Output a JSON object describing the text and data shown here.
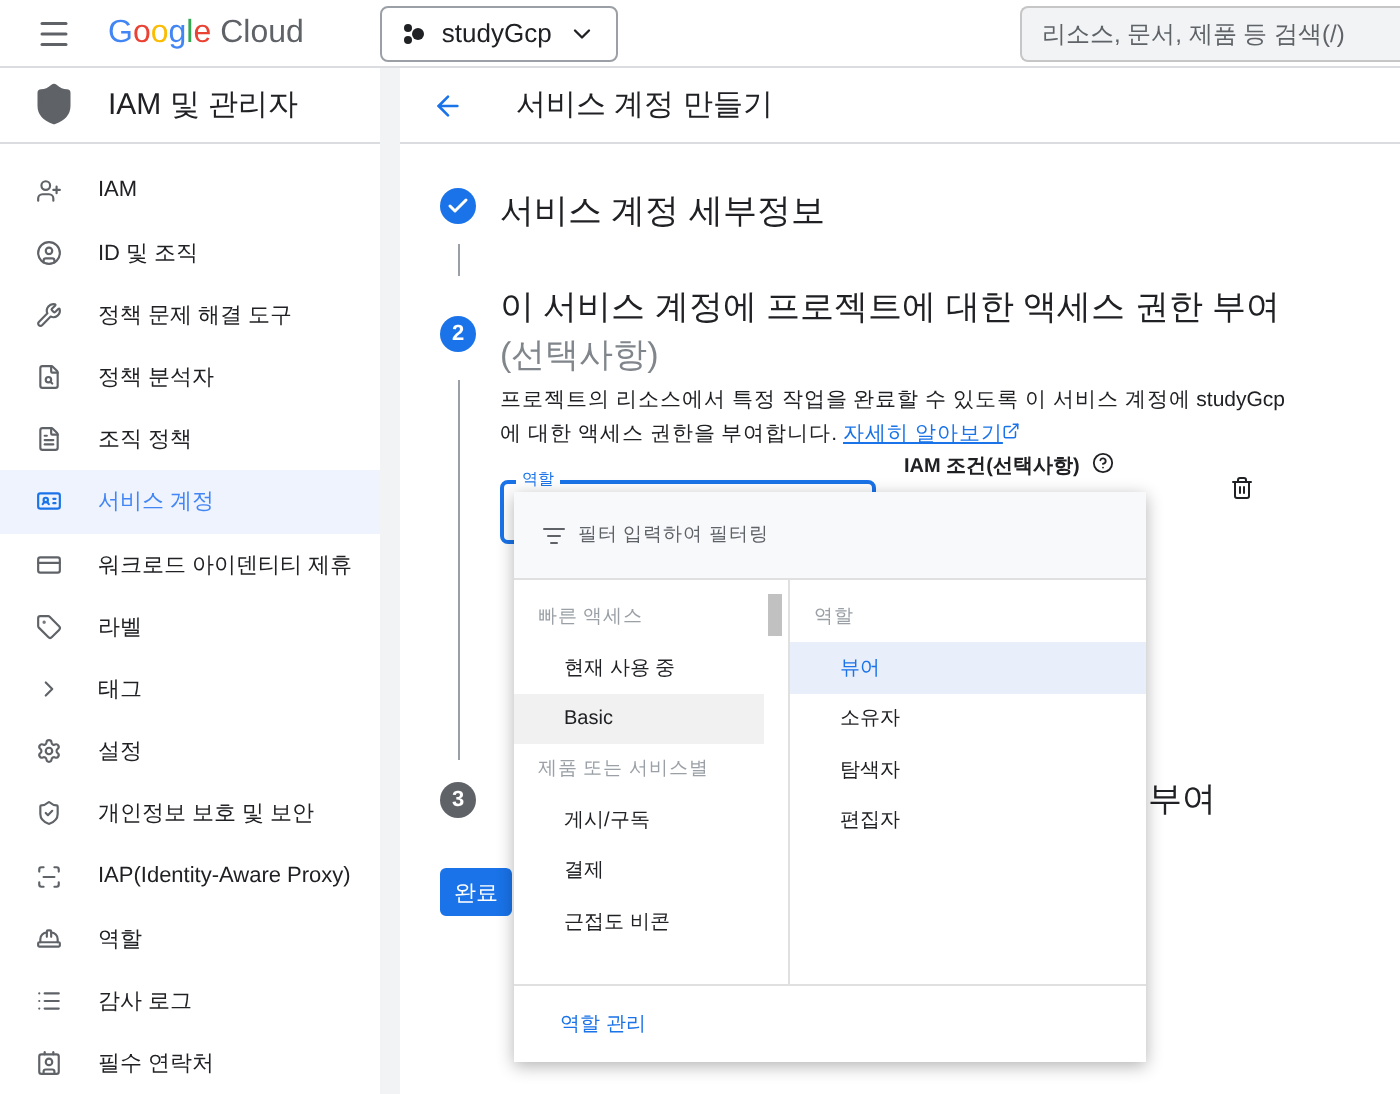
{
  "topbar": {
    "logo": "Google",
    "logo_suffix": "Cloud",
    "project": "studyGcp",
    "search": {
      "placeholder": "리소스, 문서, 제품 등 검색(/)"
    }
  },
  "sidebar": {
    "title": "IAM 및 관리자",
    "items": [
      {
        "label": "IAM",
        "selected": false
      },
      {
        "label": "ID 및 조직",
        "selected": false
      },
      {
        "label": "정책 문제 해결 도구",
        "selected": false
      },
      {
        "label": "정책 분석자",
        "selected": false
      },
      {
        "label": "조직 정책",
        "selected": false
      },
      {
        "label": "서비스 계정",
        "selected": true
      },
      {
        "label": "워크로드 아이덴티티 제휴",
        "selected": false
      },
      {
        "label": "라벨",
        "selected": false
      },
      {
        "label": "태그",
        "selected": false
      },
      {
        "label": "설정",
        "selected": false
      },
      {
        "label": "개인정보 보호 및 보안",
        "selected": false
      },
      {
        "label": "IAP(Identity-Aware Proxy)",
        "selected": false
      },
      {
        "label": "역할",
        "selected": false
      },
      {
        "label": "감사 로그",
        "selected": false
      },
      {
        "label": "필수 연락처",
        "selected": false
      }
    ]
  },
  "page": {
    "title": "서비스 계정 만들기"
  },
  "step1": {
    "title": "서비스 계정 세부정보",
    "done": true
  },
  "step2": {
    "number": "2",
    "title": "이 서비스 계정에 프로젝트에 대한 액세스 권한 부여",
    "optional": "(선택사항)",
    "description": "프로젝트의 리소스에서 특정 작업을 완료할 수 있도록 이 서비스 계정에 studyGcp 에 대한 액세스 권한을 부여합니다.",
    "link": "자세히 알아보기",
    "role_label": "역할",
    "condition_label": "IAM 조건(선택사항)"
  },
  "step3": {
    "number": "3",
    "title_end": "부여"
  },
  "done_button": "완료",
  "dropdown": {
    "filter_placeholder": "필터 입력하여 필터링",
    "groups": [
      {
        "header": "빠른 액세스",
        "items": [
          {
            "label": "현재 사용 중",
            "selected": false
          },
          {
            "label": "Basic",
            "selected": true
          }
        ]
      },
      {
        "header": "제품 또는 서비스별",
        "items": [
          {
            "label": "게시/구독",
            "selected": false
          },
          {
            "label": "결제",
            "selected": false
          },
          {
            "label": "근접도 비콘",
            "selected": false
          }
        ]
      }
    ],
    "roles_header": "역할",
    "roles": [
      {
        "label": "뷰어",
        "selected": true
      },
      {
        "label": "소유자",
        "selected": false
      },
      {
        "label": "탐색자",
        "selected": false
      },
      {
        "label": "편집자",
        "selected": false
      }
    ],
    "manage": "역할 관리"
  }
}
